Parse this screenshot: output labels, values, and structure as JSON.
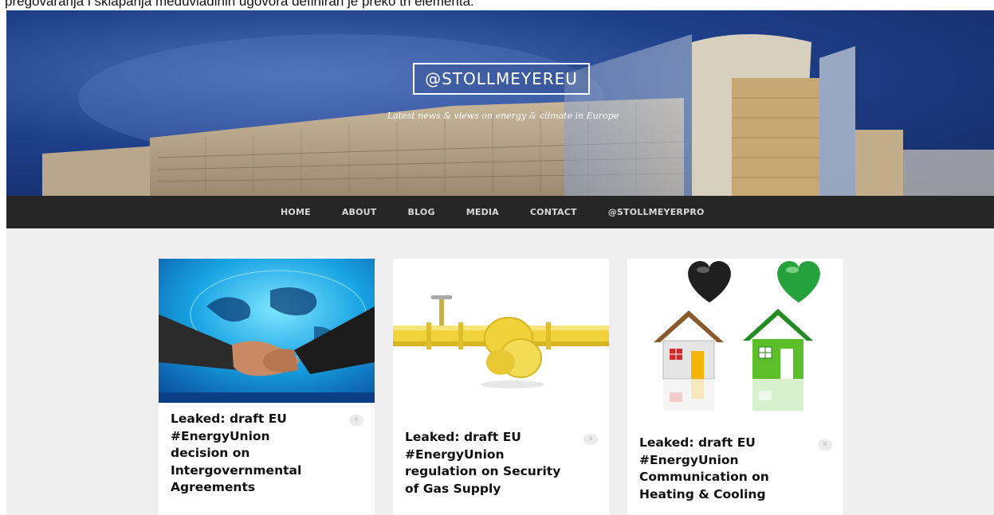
{
  "page_top_text": "pregovaranja i sklapanja međuvladinih ugovora definiran je preko tri elementa:",
  "site": {
    "title": "@STOLLMEYEREU",
    "tagline": "Latest news & views on energy & climate in Europe"
  },
  "nav": {
    "items": [
      "HOME",
      "ABOUT",
      "BLOG",
      "MEDIA",
      "CONTACT",
      "@STOLLMEYERPRO"
    ]
  },
  "posts": [
    {
      "title": "Leaked: draft EU #EnergyUnion decision on Intergovernmental Agreements",
      "comments": "0",
      "image": "handshake-globe-image"
    },
    {
      "title": "Leaked: draft EU #EnergyUnion regulation on Security of Gas Supply",
      "comments": "0",
      "image": "knotted-gas-pipe-image"
    },
    {
      "title": "Leaked: draft EU #EnergyUnion Communication on Heating & Cooling",
      "comments": "0",
      "image": "houses-hearts-image"
    }
  ],
  "colors": {
    "nav_background": "#262626",
    "page_background": "#efefef",
    "header_sky": "#1f3f8a",
    "gas_pipe": "#f0d23a",
    "green_house": "#5cbf2a"
  }
}
